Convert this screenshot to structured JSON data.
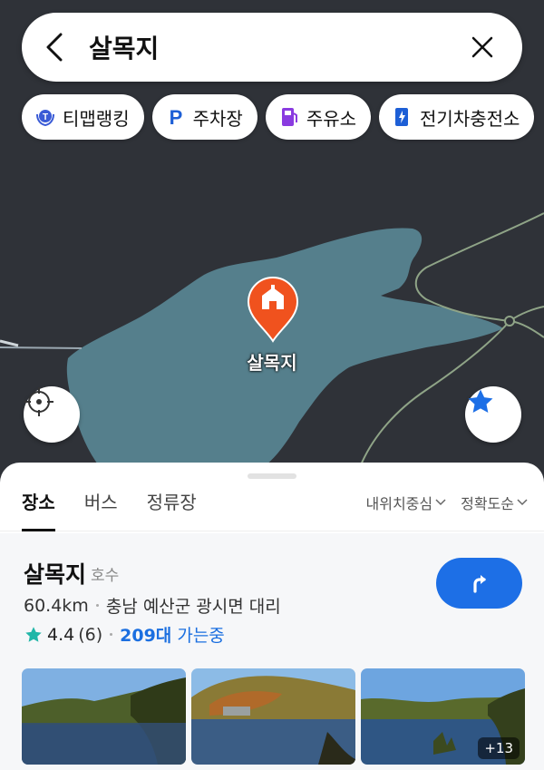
{
  "search": {
    "query": "살목지"
  },
  "chips": [
    {
      "label": "티맵랭킹",
      "icon": "tmap-ranking-icon"
    },
    {
      "label": "주차장",
      "icon": "parking-icon"
    },
    {
      "label": "주유소",
      "icon": "gas-station-icon"
    },
    {
      "label": "전기차충전소",
      "icon": "ev-charging-icon"
    }
  ],
  "map": {
    "pin_label": "살목지",
    "colors": {
      "land": "#2f3238",
      "water": "#557f8c",
      "road": "#8fa487",
      "pin": "#f0521e"
    }
  },
  "tabs": [
    {
      "label": "장소",
      "active": true
    },
    {
      "label": "버스",
      "active": false
    },
    {
      "label": "정류장",
      "active": false
    }
  ],
  "sort": {
    "center": "내위치중심",
    "order": "정확도순"
  },
  "result": {
    "name": "살목지",
    "category": "호수",
    "distance": "60.4km",
    "address": "충남 예산군 광시면 대리",
    "rating": "4.4",
    "review_count": "(6)",
    "parking_number": "209대",
    "parking_text": " 가는중",
    "more_photos": "+13"
  },
  "colors": {
    "accent": "#1d6fe6",
    "star": "#21b6a8"
  }
}
